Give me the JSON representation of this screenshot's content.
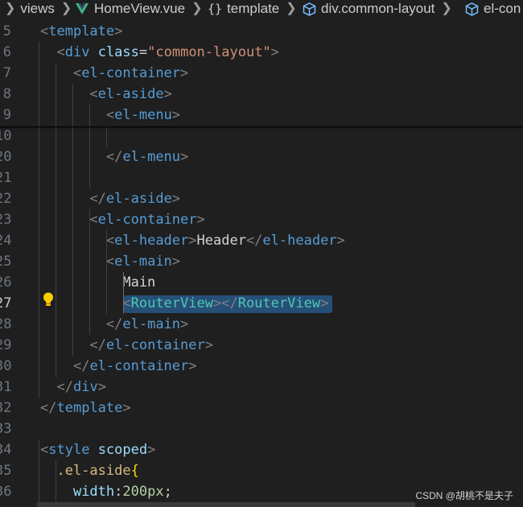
{
  "breadcrumb": {
    "items": [
      "views",
      "HomeView.vue",
      "template",
      "div.common-layout",
      "el-con"
    ],
    "icons": [
      "chevron-right-icon",
      "vue-logo-icon",
      "braces-icon",
      "cube-icon",
      "cube-icon"
    ]
  },
  "colors": {
    "background": "#1f1f1f",
    "tag": "#569cd6",
    "bracket": "#808080",
    "attribute": "#9cdcfe",
    "string": "#ce9178",
    "component": "#4ec9b0",
    "text": "#d4d4d4",
    "selector": "#d7ba7d",
    "selection": "#264f78",
    "line_number": "#6e7681",
    "lightbulb": "#ffcc00"
  },
  "editor": {
    "active_line": "27",
    "lines": [
      {
        "num": "5",
        "text": "<template>"
      },
      {
        "num": "6",
        "text": "  <div class=\"common-layout\">"
      },
      {
        "num": "7",
        "text": "    <el-container>"
      },
      {
        "num": "8",
        "text": "      <el-aside>"
      },
      {
        "num": "9",
        "text": "        <el-menu>"
      },
      {
        "num": "10",
        "text": "          |"
      },
      {
        "num": "20",
        "text": "        </el-menu>"
      },
      {
        "num": "21",
        "text": ""
      },
      {
        "num": "22",
        "text": "      </el-aside>"
      },
      {
        "num": "23",
        "text": "      <el-container>"
      },
      {
        "num": "24",
        "text": "        <el-header>Header</el-header>"
      },
      {
        "num": "25",
        "text": "        <el-main>"
      },
      {
        "num": "26",
        "text": "          Main"
      },
      {
        "num": "27",
        "text": "          <RouterView></RouterView>"
      },
      {
        "num": "28",
        "text": "        </el-main>"
      },
      {
        "num": "29",
        "text": "      </el-container>"
      },
      {
        "num": "30",
        "text": "    </el-container>"
      },
      {
        "num": "31",
        "text": "  </div>"
      },
      {
        "num": "32",
        "text": "</template>"
      },
      {
        "num": "33",
        "text": ""
      },
      {
        "num": "34",
        "text": "<style scoped>"
      },
      {
        "num": "35",
        "text": "  .el-aside{"
      },
      {
        "num": "36",
        "text": "    width:200px;"
      }
    ]
  },
  "watermark": "CSDN @胡桃不是夫子"
}
